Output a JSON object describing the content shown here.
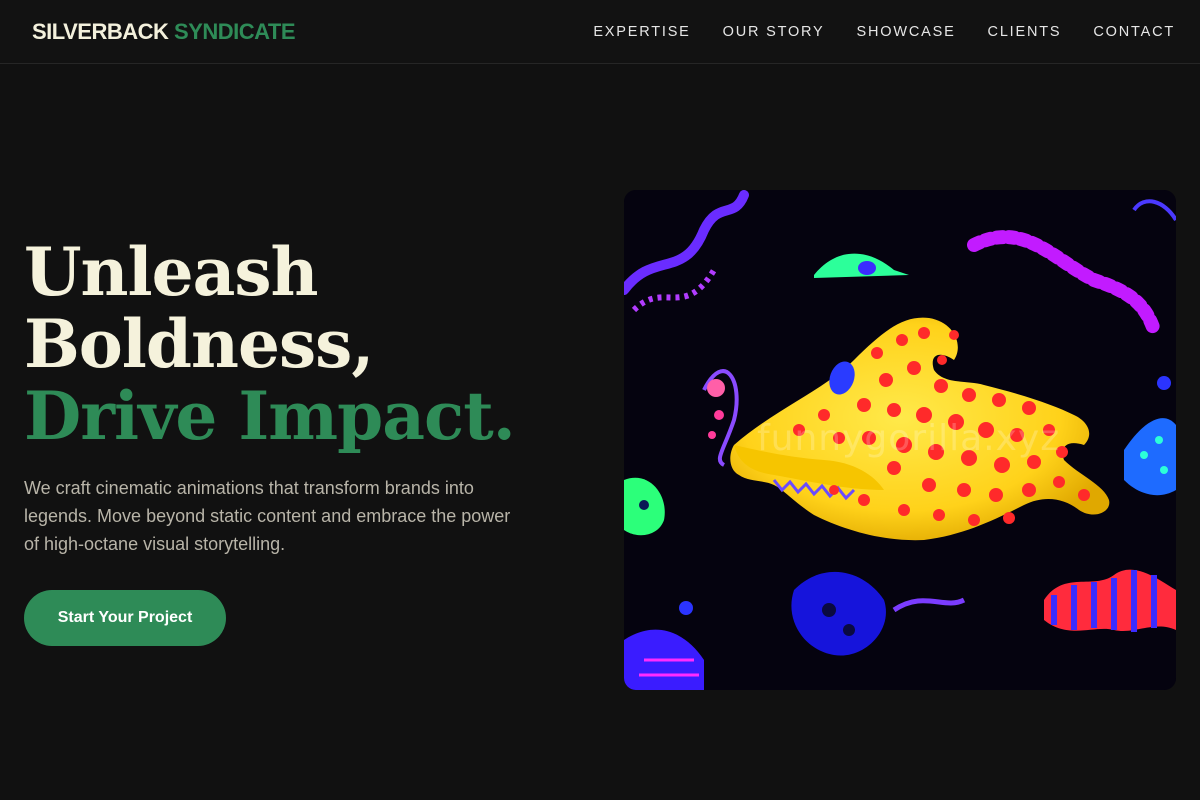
{
  "brand": {
    "part1": "SILVERBACK",
    "part2": "SYNDICATE"
  },
  "nav": [
    "EXPERTISE",
    "OUR STORY",
    "SHOWCASE",
    "CLIENTS",
    "CONTACT"
  ],
  "hero": {
    "line1": "Unleash",
    "line2": "Boldness,",
    "line3": "Drive Impact.",
    "subtitle": "We craft cinematic animations that transform brands into legends. Move beyond static content and embrace the power of high-octane visual storytelling.",
    "cta": "Start Your Project"
  },
  "artwork": {
    "watermark": "funnygorilla.xyz"
  },
  "colors": {
    "background": "#111111",
    "accent": "#2e8b57",
    "cream": "#f3f0dc",
    "muted": "#b8b4a8"
  }
}
